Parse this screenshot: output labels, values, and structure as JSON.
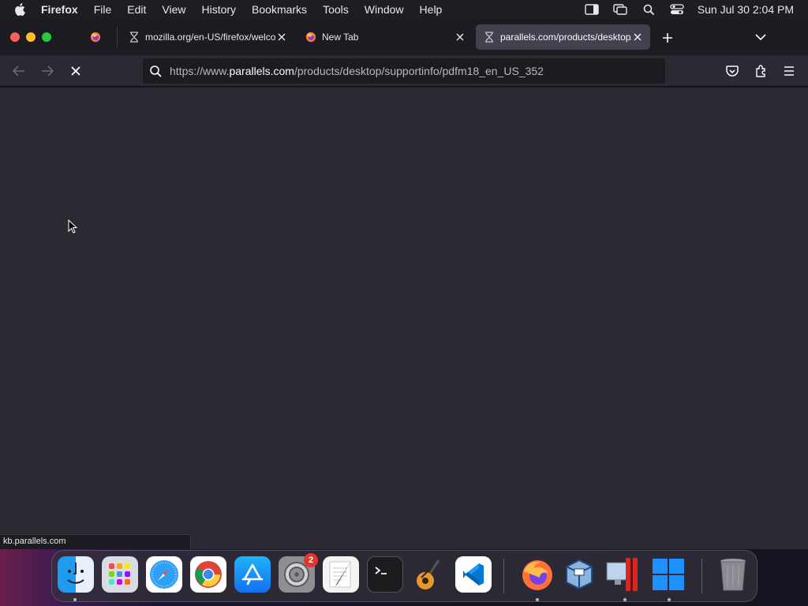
{
  "menubar": {
    "apple_icon": "apple-logo-icon",
    "app_name": "Firefox",
    "items": [
      "File",
      "Edit",
      "View",
      "History",
      "Bookmarks",
      "Tools",
      "Window",
      "Help"
    ],
    "clock": "Sun Jul 30  2:04 PM",
    "status_icons": [
      "sidebar-icon",
      "screen-mirroring-icon",
      "spotlight-search-icon",
      "control-center-icon"
    ]
  },
  "tabs": [
    {
      "title": "",
      "favicon": "firefox-icon",
      "active": false
    },
    {
      "title": "mozilla.org/en-US/firefox/welcome",
      "favicon": "hourglass-icon",
      "active": false
    },
    {
      "title": "New Tab",
      "favicon": "firefox-icon",
      "active": false
    },
    {
      "title": "parallels.com/products/desktop/",
      "favicon": "hourglass-icon",
      "active": true
    }
  ],
  "navbar": {
    "url_prefix": "https://www.",
    "url_domain": "parallels.com",
    "url_path": "/products/desktop/supportinfo/pdfm18_en_US_352"
  },
  "status_text": "kb.parallels.com",
  "dock": {
    "items": [
      {
        "name": "finder",
        "running": true
      },
      {
        "name": "launchpad",
        "running": false
      },
      {
        "name": "safari",
        "running": false
      },
      {
        "name": "chrome",
        "running": false
      },
      {
        "name": "app-store",
        "running": false
      },
      {
        "name": "system-settings",
        "running": false,
        "badge": "2"
      },
      {
        "name": "textedit",
        "running": false
      },
      {
        "name": "terminal",
        "running": false
      },
      {
        "name": "garageband",
        "running": false
      },
      {
        "name": "vscode",
        "running": false
      },
      {
        "name": "firefox",
        "running": true
      },
      {
        "name": "virtualbox",
        "running": false
      },
      {
        "name": "parallels-desktop",
        "running": true
      },
      {
        "name": "windows-11",
        "running": true
      },
      {
        "name": "trash",
        "running": false
      }
    ]
  },
  "colors": {
    "close": "#ff5f57",
    "minimize": "#febc2e",
    "maximize": "#28c840",
    "accent": "#0a84ff"
  }
}
